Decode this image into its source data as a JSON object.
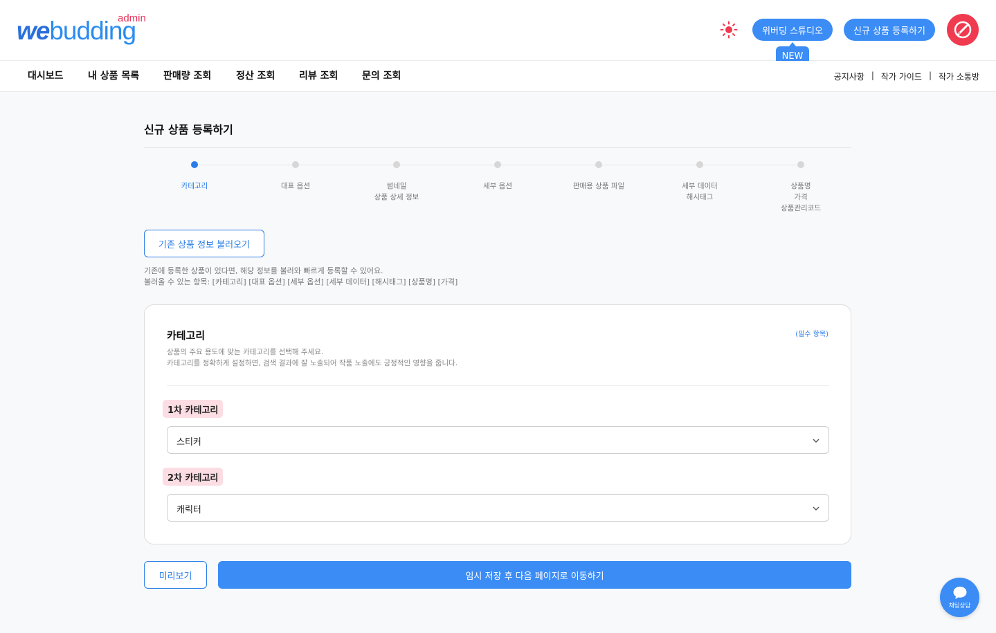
{
  "header": {
    "logo_admin": "admin",
    "logo_we": "we",
    "logo_rest": "budding",
    "studio_label": "위버딩 스튜디오",
    "new_badge": "NEW",
    "register_label": "신규 상품 등록하기",
    "icons": [
      "sun-icon",
      "pencil-icon"
    ],
    "accent": "#3b8cf5",
    "avatar_color": "#ef3a4f"
  },
  "nav": {
    "items": [
      "대시보드",
      "내 상품 목록",
      "판매량 조회",
      "정산 조회",
      "리뷰 조회",
      "문의 조회"
    ],
    "links": [
      "공지사항",
      "작가 가이드",
      "작가 소통방"
    ]
  },
  "page": {
    "title": "신규 상품 등록하기"
  },
  "steps": [
    {
      "lines": [
        "카테고리"
      ],
      "active": true
    },
    {
      "lines": [
        "대표 옵션"
      ],
      "active": false
    },
    {
      "lines": [
        "썸네일",
        "상품 상세 정보"
      ],
      "active": false
    },
    {
      "lines": [
        "세부 옵션"
      ],
      "active": false
    },
    {
      "lines": [
        "판매용 상품 파일"
      ],
      "active": false
    },
    {
      "lines": [
        "세부 데이터",
        "해시태그"
      ],
      "active": false
    },
    {
      "lines": [
        "상품명",
        "가격",
        "상품관리코드"
      ],
      "active": false
    }
  ],
  "load": {
    "button": "기존 상품 정보 불러오기",
    "desc1": "기존에 등록한 상품이 있다면, 해당 정보를 불러와 빠르게 등록할 수 있어요.",
    "desc2": "불러올 수 있는 항목: [카테고리] [대표 옵션] [세부 옵션] [세부 데이터] [해시태그] [상품명] [가격]"
  },
  "card": {
    "title": "카테고리",
    "required": "(필수 항목)",
    "desc1": "상품의 주요 용도에 맞는 카테고리를 선택해 주세요.",
    "desc2": "카테고리를 정확하게 설정하면, 검색 결과에 잘 노출되어 작품 노출에도 긍정적인 영향을 줍니다.",
    "cat1_label": "1차 카테고리",
    "cat1_value": "스티커",
    "cat2_label": "2차 카테고리",
    "cat2_value": "캐릭터"
  },
  "actions": {
    "preview": "미리보기",
    "next": "임시 저장 후 다음 페이지로 이동하기"
  },
  "chat": {
    "label": "채팅상담",
    "icon": "chat-bubble-icon"
  }
}
